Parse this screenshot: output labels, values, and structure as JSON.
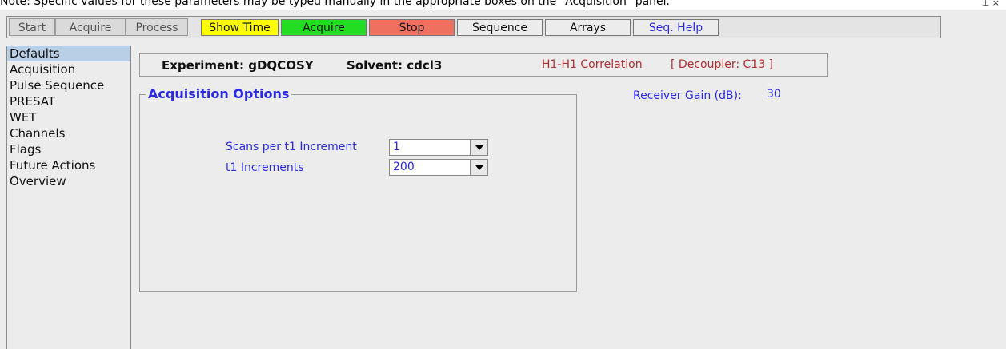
{
  "note_text": "Note: Specific values for these parameters may be typed manually in the appropriate boxes on the \"Acquisition\" panel.",
  "window_controls": "⊥ ×",
  "tabs": [
    {
      "label": "Start"
    },
    {
      "label": "Acquire"
    },
    {
      "label": "Process"
    }
  ],
  "toolbar_buttons": {
    "show_time": "Show Time",
    "acquire": "Acquire",
    "stop": "Stop",
    "sequence": "Sequence",
    "arrays": "Arrays",
    "seq_help": "Seq. Help"
  },
  "colors": {
    "show_time": "#ffff00",
    "acquire": "#22dd22",
    "stop": "#f07060",
    "link_blue": "#2a2ae0",
    "info_red": "#b03030",
    "selected": "#b8cfe5"
  },
  "sidebar": {
    "items": [
      {
        "label": "Defaults"
      },
      {
        "label": "Acquisition"
      },
      {
        "label": "Pulse Sequence"
      },
      {
        "label": "PRESAT"
      },
      {
        "label": "WET"
      },
      {
        "label": "Channels"
      },
      {
        "label": "Flags"
      },
      {
        "label": "Future Actions"
      },
      {
        "label": "Overview"
      }
    ],
    "selected": "Defaults"
  },
  "experiment": {
    "experiment_label": "Experiment: gDQCOSY",
    "solvent_label": "Solvent: cdcl3",
    "correlation": "H1-H1 Correlation",
    "decoupler": "[ Decoupler: C13 ]"
  },
  "acq_options": {
    "title": "Acquisition Options",
    "scans_label": "Scans per t1 Increment",
    "scans_value": "1",
    "increments_label": "t1 Increments",
    "increments_value": "200"
  },
  "receiver_gain": {
    "label": "Receiver Gain (dB):",
    "value": "30"
  }
}
